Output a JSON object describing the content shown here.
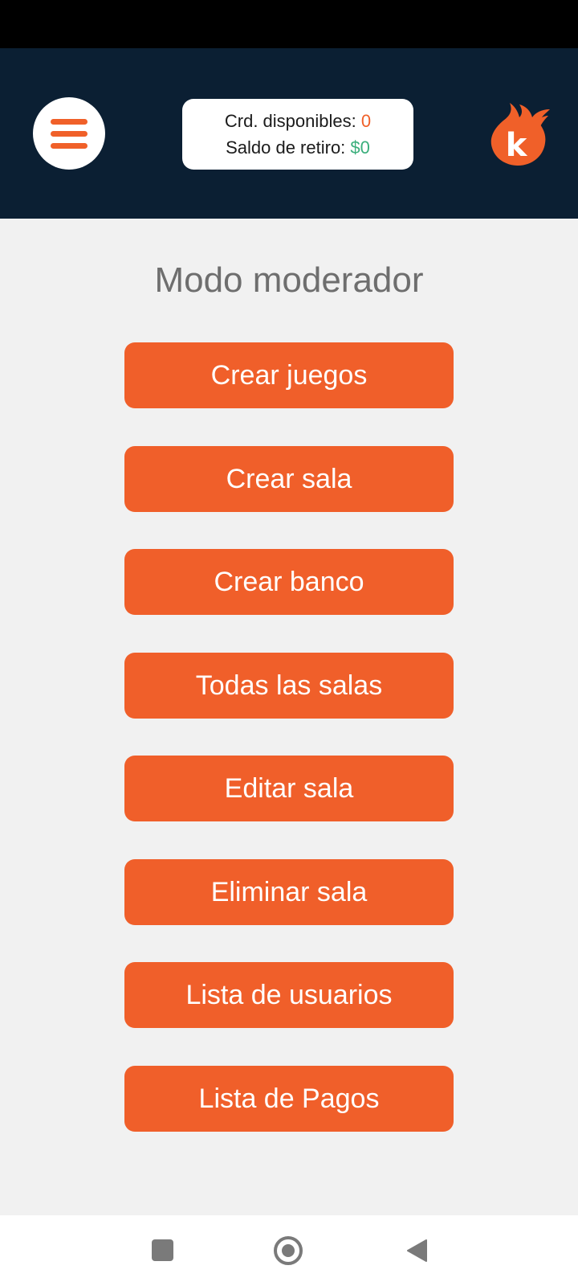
{
  "header": {
    "credits_label": "Crd. disponibles:",
    "credits_value": "0",
    "balance_label": "Saldo de retiro:",
    "balance_value": "$0",
    "logo_letter": "k"
  },
  "main": {
    "title": "Modo moderador",
    "buttons": [
      {
        "label": "Crear juegos"
      },
      {
        "label": "Crear sala"
      },
      {
        "label": "Crear banco"
      },
      {
        "label": "Todas las salas"
      },
      {
        "label": "Editar sala"
      },
      {
        "label": "Eliminar sala"
      },
      {
        "label": "Lista de usuarios"
      },
      {
        "label": "Lista de Pagos"
      }
    ]
  },
  "icons": {
    "menu": "hamburger-menu-icon",
    "logo": "flame-k-logo",
    "nav_recents": "square-icon",
    "nav_home": "circle-home-icon",
    "nav_back": "triangle-back-icon"
  },
  "colors": {
    "accent": "#f05f2a",
    "header_bg": "#0b1f33",
    "credits": "#f06029",
    "balance": "#3aae7b"
  }
}
